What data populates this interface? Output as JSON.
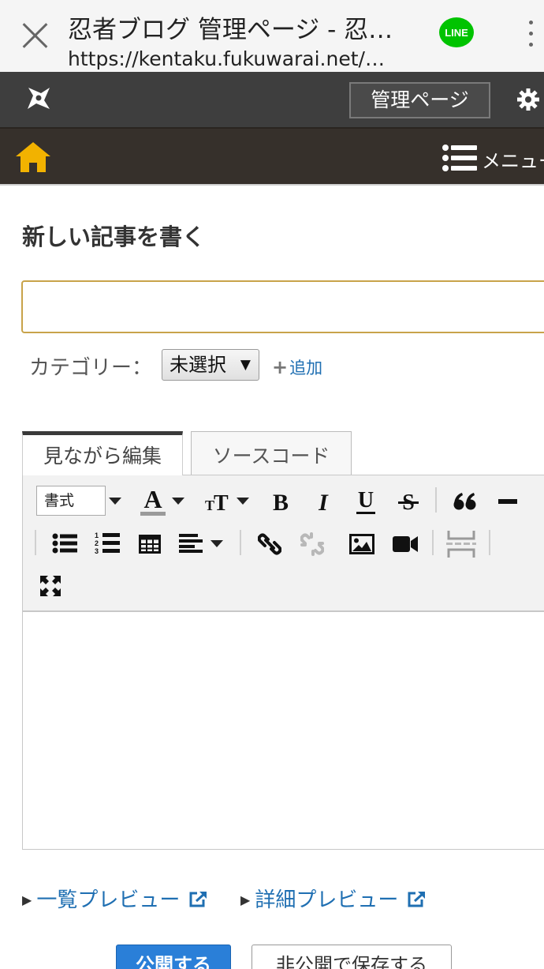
{
  "browser": {
    "title": "忍者ブログ 管理ページ - 忍…",
    "url": "https://kentaku.fukuwarai.net/…",
    "line_label": "LINE"
  },
  "admin_bar": {
    "admin_button": "管理ページ"
  },
  "nav": {
    "menu_label": "メニュー"
  },
  "page": {
    "title": "新しい記事を書く",
    "title_input_value": "",
    "category_label": "カテゴリー：",
    "category_selected": "未選択",
    "add_label": "追加"
  },
  "editor": {
    "tabs": [
      {
        "label": "見ながら編集",
        "active": true
      },
      {
        "label": "ソースコード",
        "active": false
      }
    ],
    "format_select": "書式",
    "toolbar_icons": [
      "font-color-icon",
      "font-size-icon",
      "bold-icon",
      "italic-icon",
      "underline-icon",
      "strikethrough-icon",
      "blockquote-icon",
      "horizontal-rule-icon",
      "bullet-list-icon",
      "numbered-list-icon",
      "table-icon",
      "align-icon",
      "link-icon",
      "unlink-icon",
      "image-icon",
      "video-icon",
      "page-break-icon",
      "fullscreen-icon"
    ]
  },
  "preview": {
    "list_preview": "一覧プレビュー",
    "detail_preview": "詳細プレビュー"
  },
  "actions": {
    "publish": "公開する",
    "save_private": "非公開で保存する"
  },
  "colors": {
    "admin_bar": "#3e3e3e",
    "nav_bar": "#36302b",
    "home_icon": "#f2b200",
    "line_green": "#00c300",
    "link_blue": "#1f6fb2",
    "publish_blue": "#2a7fd8"
  }
}
